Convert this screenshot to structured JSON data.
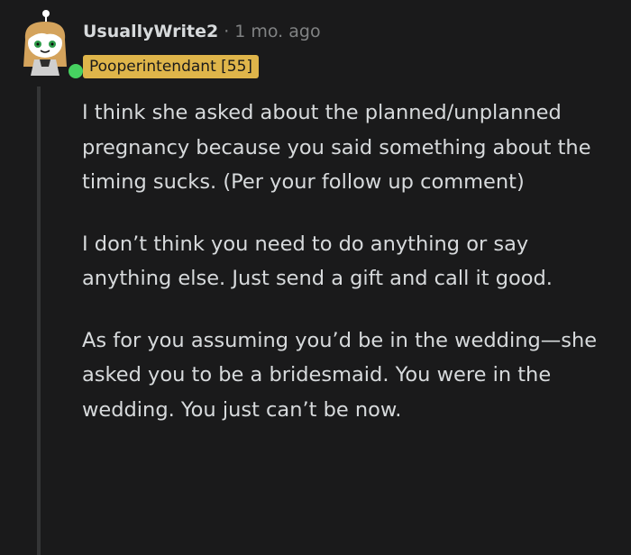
{
  "comment": {
    "username": "UsuallyWrite2",
    "separator": "·",
    "timestamp": "1 mo. ago",
    "flair": "Pooperintendant [55]",
    "paragraphs": [
      "I think she asked about the planned/unplanned pregnancy because you said something about the timing sucks. (Per your follow up comment)",
      "I don’t think you need to do anything or say anything else. Just send a gift and call it good.",
      "As for you assuming you’d be in the wedding—she asked you to be a bridesmaid. You were in the wedding. You just can’t be now."
    ]
  },
  "colors": {
    "background": "#1a1a1b",
    "text": "#d7dadc",
    "muted": "#818384",
    "flair_bg": "#dfb54a",
    "online": "#46d160",
    "thread_line": "#343536"
  },
  "icons": {
    "avatar": "snoo-avatar",
    "online": "online-status-dot"
  }
}
